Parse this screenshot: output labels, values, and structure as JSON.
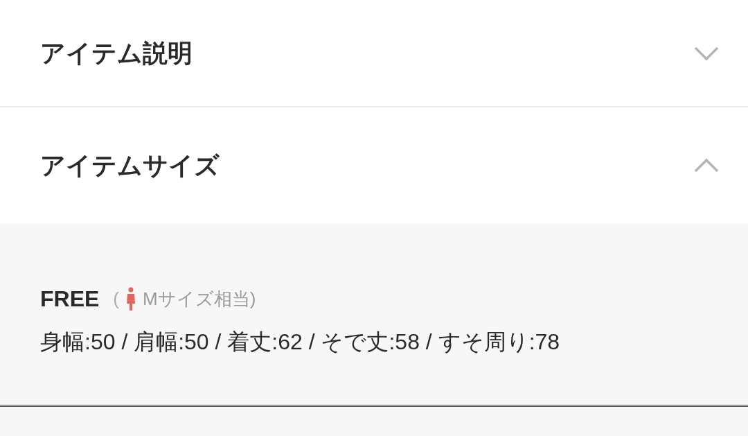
{
  "sections": [
    {
      "title": "アイテム説明",
      "expanded": false
    },
    {
      "title": "アイテムサイズ",
      "expanded": true,
      "size": {
        "label": "FREE",
        "paren_open": "(",
        "equivalent": "Mサイズ相当)",
        "measurements": "身幅:50 / 肩幅:50 / 着丈:62 / そで丈:58 / すそ周り:78"
      }
    }
  ]
}
